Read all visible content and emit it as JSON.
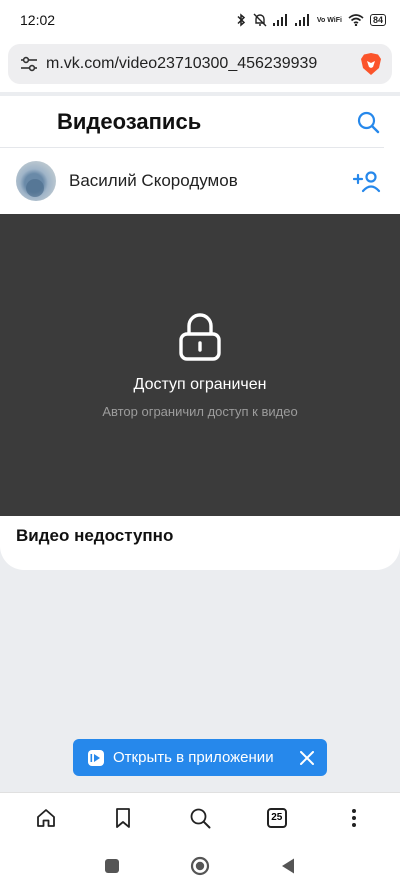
{
  "status_bar": {
    "time": "12:02",
    "network_label": "Vo WiFi",
    "battery": "84"
  },
  "browser": {
    "url": "m.vk.com/video23710300_456239939",
    "tab_count": "25"
  },
  "page": {
    "title": "Видеозапись",
    "author_name": "Василий Скородумов",
    "restricted_title": "Доступ ограничен",
    "restricted_subtitle": "Автор ограничил доступ к видео",
    "video_status": "Видео недоступно"
  },
  "banner": {
    "label": "Открыть в приложении"
  },
  "colors": {
    "accent": "#2688eb",
    "player_bg": "#3b3b3b",
    "page_bg": "#ebedf0"
  },
  "icons": [
    "bluetooth-icon",
    "mute-bell-icon",
    "signal-icon",
    "wifi-icon",
    "battery-icon",
    "site-settings-icon",
    "brave-lion-icon",
    "search-icon",
    "add-friend-icon",
    "lock-icon",
    "vk-video-icon",
    "close-icon",
    "home-icon",
    "bookmark-icon",
    "tabs-icon",
    "more-icon",
    "recents-icon",
    "home-circle-icon",
    "back-icon"
  ]
}
